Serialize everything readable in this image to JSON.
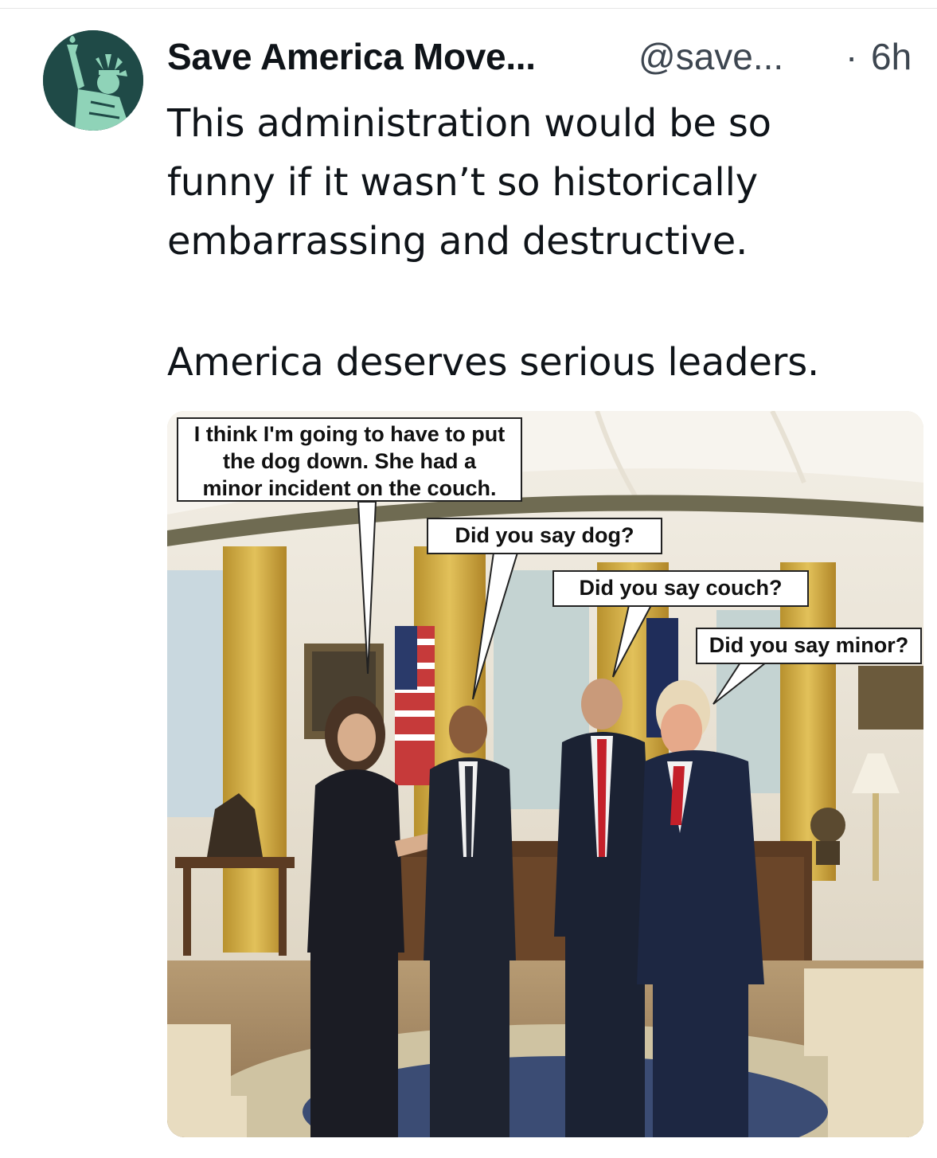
{
  "post": {
    "author_name": "Save America Move...",
    "handle": "@save...",
    "separator": "·",
    "time": "6h",
    "lines": [
      "This administration would be so",
      "funny if it wasn’t so historically",
      "embarrassing and destructive.",
      "America deserves serious leaders."
    ]
  },
  "avatar": {
    "icon": "statue-of-liberty-icon",
    "bg": "#1f4a47",
    "fg": "#8fd3b8"
  },
  "image": {
    "bubbles": [
      {
        "lines": [
          "I think I'm going to have to put",
          "the dog down. She had a",
          "minor incident on the couch."
        ]
      },
      {
        "text": "Did you say dog?"
      },
      {
        "text": "Did you say couch?"
      },
      {
        "text": "Did you say minor?"
      }
    ]
  },
  "colors": {
    "text": "#0f1419",
    "secondary": "#3d4650"
  }
}
